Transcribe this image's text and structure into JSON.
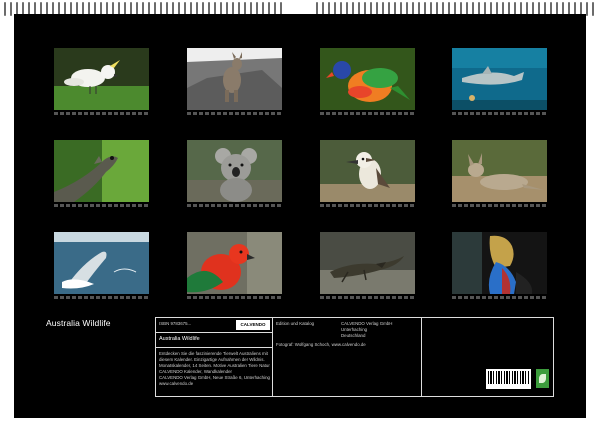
{
  "calendar": {
    "title": "Australia Wildlife"
  },
  "photos": [
    {
      "subject": "Cockatoo"
    },
    {
      "subject": "Wallaby"
    },
    {
      "subject": "Rainbow lorikeet"
    },
    {
      "subject": "Shark in aquarium"
    },
    {
      "subject": "Water dragon"
    },
    {
      "subject": "Koala"
    },
    {
      "subject": "Kookaburra"
    },
    {
      "subject": "Kangaroo"
    },
    {
      "subject": "Humpback whale"
    },
    {
      "subject": "King parrot"
    },
    {
      "subject": "Lizard"
    },
    {
      "subject": "Cassowary"
    }
  ],
  "info": {
    "isbn_label": "ISBN 9783675...",
    "publisher_badge": "CALVENDO",
    "product_title": "Australia Wildlife",
    "description_lines": [
      "Entdecken Sie die faszinierende Tierwelt Australiens mit",
      "diesem Kalender. Einzigartige Aufnahmen der Wildnis.",
      "Monatskalender, 14 Seiten. Motive Australien Tiere Natur",
      "CALVENDO Kalender, Wandkalender",
      "CALVENDO Verlag GmbH, Neue Straße 6, Unterhaching",
      "www.calvendo.de"
    ],
    "col2_header": "Edition und Katalog",
    "publisher_lines": [
      "CALVENDO Verlag GmbH",
      "Unterhaching",
      "Deutschland"
    ],
    "credit_line": "Fotograf: Wolfgang Schoch, www.calvendo.de"
  },
  "colors": {
    "page": "#000000",
    "border": "#dddddd",
    "text": "#ffffff"
  }
}
